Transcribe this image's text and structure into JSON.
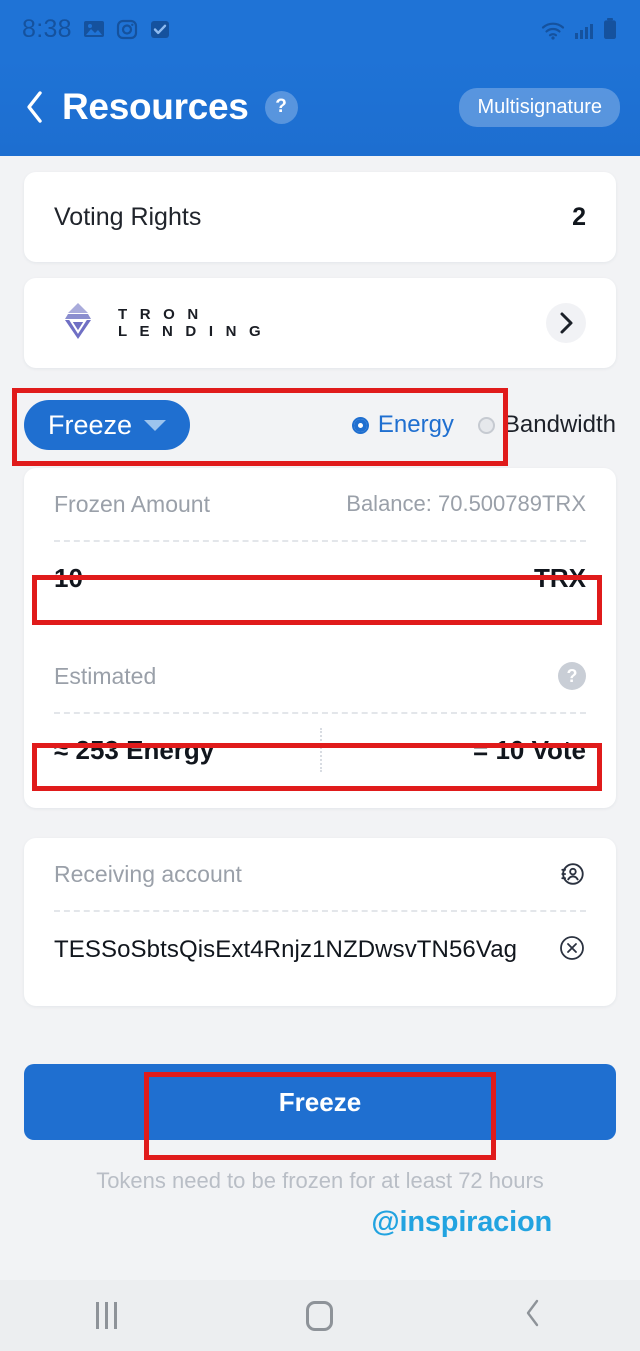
{
  "statusbar": {
    "time": "8:38",
    "icons": [
      "gallery-icon",
      "instagram-icon",
      "checkbox-icon"
    ],
    "right_icons": [
      "wifi-icon",
      "cellular-signal-icon",
      "battery-icon"
    ]
  },
  "header": {
    "back_label": "‹",
    "title": "Resources",
    "help_label": "?",
    "multisignature_label": "Multisignature"
  },
  "voting": {
    "label": "Voting Rights",
    "value": "2"
  },
  "lending": {
    "brand_line1": "T R O N",
    "brand_line2": "L E N D I N G",
    "chevron": "›"
  },
  "action": {
    "mode_label": "Freeze",
    "resource_options": [
      {
        "label": "Energy",
        "selected": true
      },
      {
        "label": "Bandwidth",
        "selected": false
      }
    ]
  },
  "amount": {
    "label": "Frozen Amount",
    "balance": "Balance: 70.500789TRX",
    "value": "10",
    "unit": "TRX"
  },
  "estimated": {
    "label": "Estimated",
    "help_label": "?",
    "energy": "≈ 253 Energy",
    "vote": "= 10 Vote"
  },
  "receiving": {
    "label": "Receiving account",
    "contact_icon": "address-book-icon",
    "address": "TESSoSbtsQisExt4Rnjz1NZDwsvTN56Vag",
    "clear_icon": "clear-circle-icon"
  },
  "cta": {
    "label": "Freeze",
    "note": "Tokens need to be frozen for at least 72 hours"
  },
  "watermark": {
    "text": "@inspiracion"
  },
  "navbar": {
    "recents": "recents-icon",
    "home": "home-icon",
    "back": "back-icon"
  },
  "colors": {
    "brand_blue": "#1f6fd0",
    "header_blue": "#1f73d6",
    "annotation_red": "#e01b1b",
    "watermark_blue": "#22a3e0",
    "logo_purple": "#6f6fc4"
  }
}
